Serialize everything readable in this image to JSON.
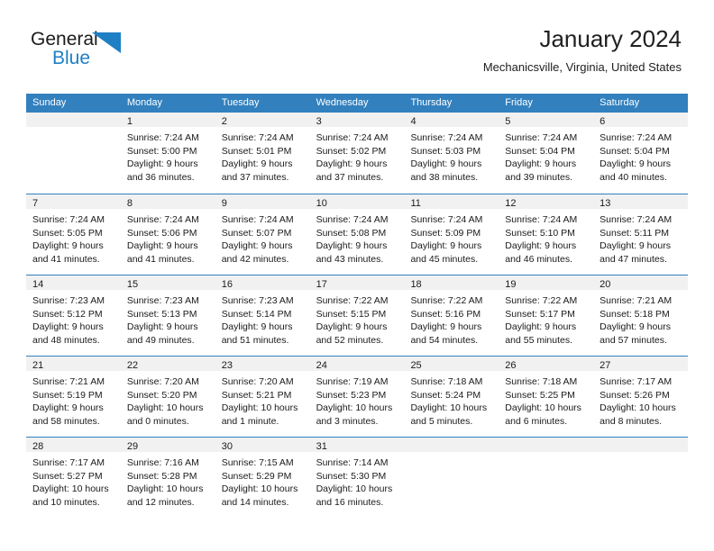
{
  "brand": {
    "name_part1": "General",
    "name_part2": "Blue",
    "accent_color": "#1f7fc4"
  },
  "header": {
    "title": "January 2024",
    "subtitle": "Mechanicsville, Virginia, United States"
  },
  "calendar": {
    "header_bg": "#3280be",
    "daynum_strip_bg": "#f1f1f1",
    "weekdays": [
      "Sunday",
      "Monday",
      "Tuesday",
      "Wednesday",
      "Thursday",
      "Friday",
      "Saturday"
    ],
    "weeks": [
      [
        {
          "day": "",
          "lines": []
        },
        {
          "day": "1",
          "lines": [
            "Sunrise: 7:24 AM",
            "Sunset: 5:00 PM",
            "Daylight: 9 hours",
            "and 36 minutes."
          ]
        },
        {
          "day": "2",
          "lines": [
            "Sunrise: 7:24 AM",
            "Sunset: 5:01 PM",
            "Daylight: 9 hours",
            "and 37 minutes."
          ]
        },
        {
          "day": "3",
          "lines": [
            "Sunrise: 7:24 AM",
            "Sunset: 5:02 PM",
            "Daylight: 9 hours",
            "and 37 minutes."
          ]
        },
        {
          "day": "4",
          "lines": [
            "Sunrise: 7:24 AM",
            "Sunset: 5:03 PM",
            "Daylight: 9 hours",
            "and 38 minutes."
          ]
        },
        {
          "day": "5",
          "lines": [
            "Sunrise: 7:24 AM",
            "Sunset: 5:04 PM",
            "Daylight: 9 hours",
            "and 39 minutes."
          ]
        },
        {
          "day": "6",
          "lines": [
            "Sunrise: 7:24 AM",
            "Sunset: 5:04 PM",
            "Daylight: 9 hours",
            "and 40 minutes."
          ]
        }
      ],
      [
        {
          "day": "7",
          "lines": [
            "Sunrise: 7:24 AM",
            "Sunset: 5:05 PM",
            "Daylight: 9 hours",
            "and 41 minutes."
          ]
        },
        {
          "day": "8",
          "lines": [
            "Sunrise: 7:24 AM",
            "Sunset: 5:06 PM",
            "Daylight: 9 hours",
            "and 41 minutes."
          ]
        },
        {
          "day": "9",
          "lines": [
            "Sunrise: 7:24 AM",
            "Sunset: 5:07 PM",
            "Daylight: 9 hours",
            "and 42 minutes."
          ]
        },
        {
          "day": "10",
          "lines": [
            "Sunrise: 7:24 AM",
            "Sunset: 5:08 PM",
            "Daylight: 9 hours",
            "and 43 minutes."
          ]
        },
        {
          "day": "11",
          "lines": [
            "Sunrise: 7:24 AM",
            "Sunset: 5:09 PM",
            "Daylight: 9 hours",
            "and 45 minutes."
          ]
        },
        {
          "day": "12",
          "lines": [
            "Sunrise: 7:24 AM",
            "Sunset: 5:10 PM",
            "Daylight: 9 hours",
            "and 46 minutes."
          ]
        },
        {
          "day": "13",
          "lines": [
            "Sunrise: 7:24 AM",
            "Sunset: 5:11 PM",
            "Daylight: 9 hours",
            "and 47 minutes."
          ]
        }
      ],
      [
        {
          "day": "14",
          "lines": [
            "Sunrise: 7:23 AM",
            "Sunset: 5:12 PM",
            "Daylight: 9 hours",
            "and 48 minutes."
          ]
        },
        {
          "day": "15",
          "lines": [
            "Sunrise: 7:23 AM",
            "Sunset: 5:13 PM",
            "Daylight: 9 hours",
            "and 49 minutes."
          ]
        },
        {
          "day": "16",
          "lines": [
            "Sunrise: 7:23 AM",
            "Sunset: 5:14 PM",
            "Daylight: 9 hours",
            "and 51 minutes."
          ]
        },
        {
          "day": "17",
          "lines": [
            "Sunrise: 7:22 AM",
            "Sunset: 5:15 PM",
            "Daylight: 9 hours",
            "and 52 minutes."
          ]
        },
        {
          "day": "18",
          "lines": [
            "Sunrise: 7:22 AM",
            "Sunset: 5:16 PM",
            "Daylight: 9 hours",
            "and 54 minutes."
          ]
        },
        {
          "day": "19",
          "lines": [
            "Sunrise: 7:22 AM",
            "Sunset: 5:17 PM",
            "Daylight: 9 hours",
            "and 55 minutes."
          ]
        },
        {
          "day": "20",
          "lines": [
            "Sunrise: 7:21 AM",
            "Sunset: 5:18 PM",
            "Daylight: 9 hours",
            "and 57 minutes."
          ]
        }
      ],
      [
        {
          "day": "21",
          "lines": [
            "Sunrise: 7:21 AM",
            "Sunset: 5:19 PM",
            "Daylight: 9 hours",
            "and 58 minutes."
          ]
        },
        {
          "day": "22",
          "lines": [
            "Sunrise: 7:20 AM",
            "Sunset: 5:20 PM",
            "Daylight: 10 hours",
            "and 0 minutes."
          ]
        },
        {
          "day": "23",
          "lines": [
            "Sunrise: 7:20 AM",
            "Sunset: 5:21 PM",
            "Daylight: 10 hours",
            "and 1 minute."
          ]
        },
        {
          "day": "24",
          "lines": [
            "Sunrise: 7:19 AM",
            "Sunset: 5:23 PM",
            "Daylight: 10 hours",
            "and 3 minutes."
          ]
        },
        {
          "day": "25",
          "lines": [
            "Sunrise: 7:18 AM",
            "Sunset: 5:24 PM",
            "Daylight: 10 hours",
            "and 5 minutes."
          ]
        },
        {
          "day": "26",
          "lines": [
            "Sunrise: 7:18 AM",
            "Sunset: 5:25 PM",
            "Daylight: 10 hours",
            "and 6 minutes."
          ]
        },
        {
          "day": "27",
          "lines": [
            "Sunrise: 7:17 AM",
            "Sunset: 5:26 PM",
            "Daylight: 10 hours",
            "and 8 minutes."
          ]
        }
      ],
      [
        {
          "day": "28",
          "lines": [
            "Sunrise: 7:17 AM",
            "Sunset: 5:27 PM",
            "Daylight: 10 hours",
            "and 10 minutes."
          ]
        },
        {
          "day": "29",
          "lines": [
            "Sunrise: 7:16 AM",
            "Sunset: 5:28 PM",
            "Daylight: 10 hours",
            "and 12 minutes."
          ]
        },
        {
          "day": "30",
          "lines": [
            "Sunrise: 7:15 AM",
            "Sunset: 5:29 PM",
            "Daylight: 10 hours",
            "and 14 minutes."
          ]
        },
        {
          "day": "31",
          "lines": [
            "Sunrise: 7:14 AM",
            "Sunset: 5:30 PM",
            "Daylight: 10 hours",
            "and 16 minutes."
          ]
        },
        {
          "day": "",
          "lines": []
        },
        {
          "day": "",
          "lines": []
        },
        {
          "day": "",
          "lines": []
        }
      ]
    ]
  }
}
